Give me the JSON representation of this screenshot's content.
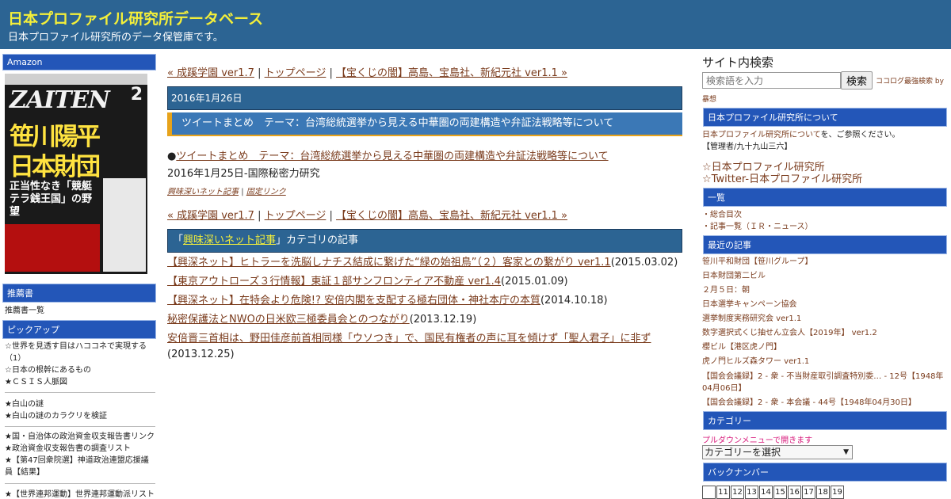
{
  "header": {
    "title": "日本プロファイル研究所データベース",
    "description": "日本プロファイル研究所のデータ保管庫です。"
  },
  "left": {
    "amazon_head": "Amazon",
    "book": {
      "logo": "ZAITEN",
      "issue": "2",
      "headline1": "笹川陽平",
      "headline2": "日本財団",
      "subhead": "正当性なき「競艇テラ銭王国」の野望"
    },
    "recommend_head": "推薦書",
    "recommend_items": [
      "推薦書一覧"
    ],
    "pickup_head": "ピックアップ",
    "pickup_groups": [
      [
        "☆世界を見透す目はハココネで実現する（1）",
        "☆日本の根幹にあるもの",
        "★ＣＳＩＳ人脈図"
      ],
      [
        "★白山の謎",
        "★白山の謎のカラクリを検証"
      ],
      [
        "★国・自治体の政治資金収支報告書リンク",
        "★政治資金収支報告書の調査リスト",
        "★【第47回衆院選】神道政治連盟応援議員【結果】"
      ],
      [
        "★【世界連邦運動】世界連邦運動派リスト"
      ]
    ]
  },
  "main": {
    "nav": {
      "prev": "« 成蹊学園 ver1.7",
      "sep": "|",
      "top": "トップページ",
      "next": "【宝くじの闇】高島、宝島社、新紀元社 ver1.1 »"
    },
    "date": "2016年1月26日",
    "post_title": "ツイートまとめ　テーマ：台湾総統選挙から見える中華圏の両建構造や弁証法戦略等について",
    "post_bullet": "●",
    "post_link": "ツイートまとめ　テーマ：台湾総統選挙から見える中華圏の両建構造や弁証法戦略等について",
    "post_source": "2016年1月25日-国際秘密力研究",
    "meta_category": "興味深いネット記事",
    "meta_sep": "|",
    "meta_permalink": "固定リンク",
    "category_link": "興味深いネット記事",
    "category_suffix": "カテゴリの記事",
    "category_prefix": "「",
    "category_close": "」",
    "articles": [
      {
        "title": "【興深ネット】ヒトラーを洗脳しナチス結成に繋げた“緑の始祖鳥”（２）客家との繋がり ver1.1",
        "date": "(2015.03.02)"
      },
      {
        "title": "【東京アウトローズ３行情報】東証１部サンフロンティア不動産 ver1.4",
        "date": "(2015.01.09)"
      },
      {
        "title": "【興深ネット】在特会より危険!? 安倍内閣を支配する極右団体・神社本庁の本質",
        "date": "(2014.10.18)"
      },
      {
        "title": "秘密保護法とNWOの日米欧三極委員会とのつながり",
        "date": "(2013.12.19)"
      },
      {
        "title": "安倍晋三首相は、野田佳彦前首相同様「ウソつき」で、国民有権者の声に耳を傾けず「聖人君子」に非ず",
        "date": "(2013.12.25)"
      }
    ]
  },
  "right": {
    "search_title": "サイト内検索",
    "search_placeholder": "検索語を入力",
    "search_button": "検索",
    "search_note": "ココログ最強検索 by",
    "search_note2": "暴想",
    "about_head": "日本プロファイル研究所について",
    "about_link": "日本プロファイル研究所について",
    "about_text": "を、ご参照ください。",
    "admin": "【管理者/九十九山三六】",
    "big_links": [
      "☆日本プロファイル研究所",
      "☆Twitter-日本プロファイル研究所"
    ],
    "list_head": "一覧",
    "list_items": [
      "・総合目次",
      "・記事一覧（ＩＲ・ニュース）"
    ],
    "recent_head": "最近の記事",
    "recent_items": [
      "笹川平和財団【笹川グループ】",
      "日本財団第二ビル",
      "２月５日：朝",
      "日本選挙キャンペーン協会",
      "選挙制度実務研究会 ver1.1",
      "数字選択式くじ抽せん立会人【2019年】 ver1.2",
      "櫻ビル【港区虎ノ門】",
      "虎ノ門ヒルズ森タワー ver1.1",
      "【国会会議録】2 - 衆 - 不当財産取引調査特別委… - 12号【1948年04月06日】",
      "【国会会議録】2 - 衆 - 本会議 - 44号【1948年04月30日】"
    ],
    "category_head": "カテゴリー",
    "category_note": "プルダウンメニューで開きます",
    "category_select": "カテゴリーを選択",
    "backnumber_head": "バックナンバー",
    "calendar": [
      "",
      "11",
      "12",
      "13",
      "14",
      "15",
      "16",
      "17",
      "18",
      "19"
    ]
  },
  "colors": {
    "header_bg": "#2c6493",
    "title_yellow": "#f4ef3a",
    "side_head_bg": "#2356b8",
    "link": "#7a3b1c",
    "accent_orange": "#e7a31b"
  }
}
